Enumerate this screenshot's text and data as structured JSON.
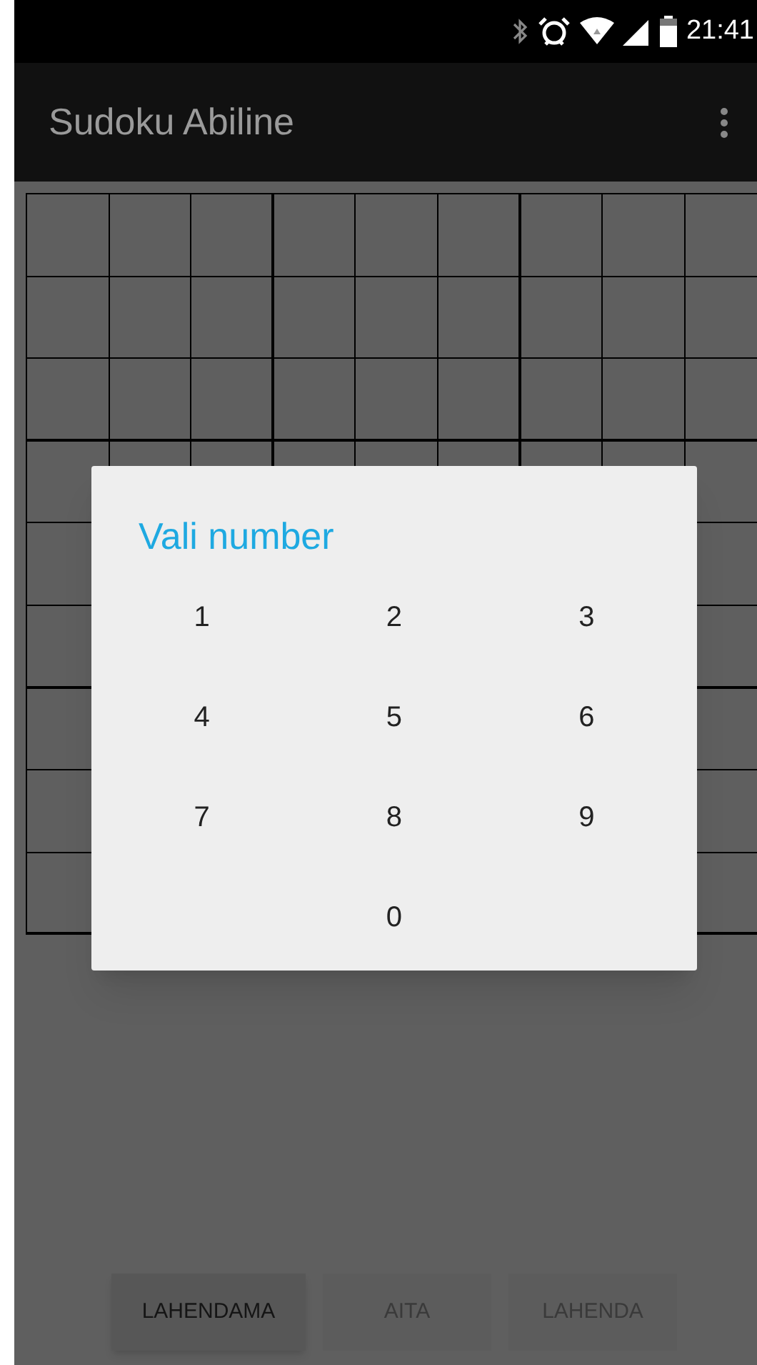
{
  "status_bar": {
    "time": "21:41"
  },
  "app_bar": {
    "title": "Sudoku Abiline"
  },
  "dialog": {
    "title": "Vali number",
    "numbers": [
      "1",
      "2",
      "3",
      "4",
      "5",
      "6",
      "7",
      "8",
      "9",
      "0"
    ]
  },
  "buttons": [
    {
      "label": "LAHENDAMA",
      "disabled": false
    },
    {
      "label": "AITA",
      "disabled": true
    },
    {
      "label": "LAHENDA",
      "disabled": true
    }
  ]
}
